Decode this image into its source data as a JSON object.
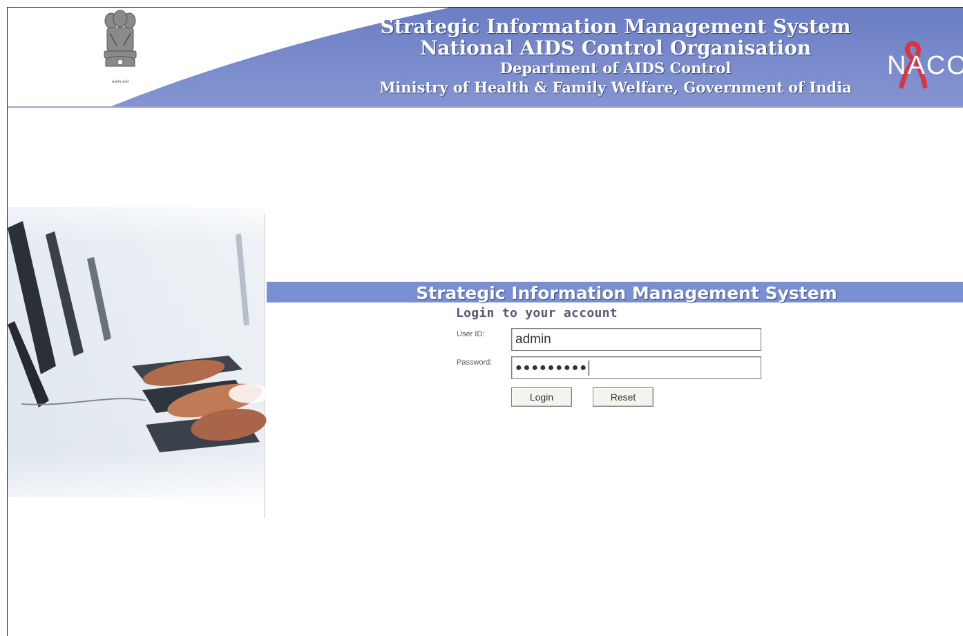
{
  "header": {
    "title_line1": "Strategic Information Management System",
    "title_line2": "National AIDS Control Organisation",
    "title_line3": "Department of AIDS Control",
    "title_line4": "Ministry of Health & Family Welfare, Government of India",
    "logo_text": "NACO",
    "emblem_caption": "सत्यमेव जयते"
  },
  "login": {
    "banner_title": "Strategic Information Management System",
    "heading": "Login to your account",
    "userid_label": "User ID:",
    "userid_value": "admin",
    "password_label": "Password:",
    "password_masked": "●●●●●●●●●",
    "login_button": "Login",
    "reset_button": "Reset"
  },
  "colors": {
    "header_blue": "#7384c8",
    "banner_blue": "#7a8fd0",
    "ribbon_red": "#d7373f"
  }
}
